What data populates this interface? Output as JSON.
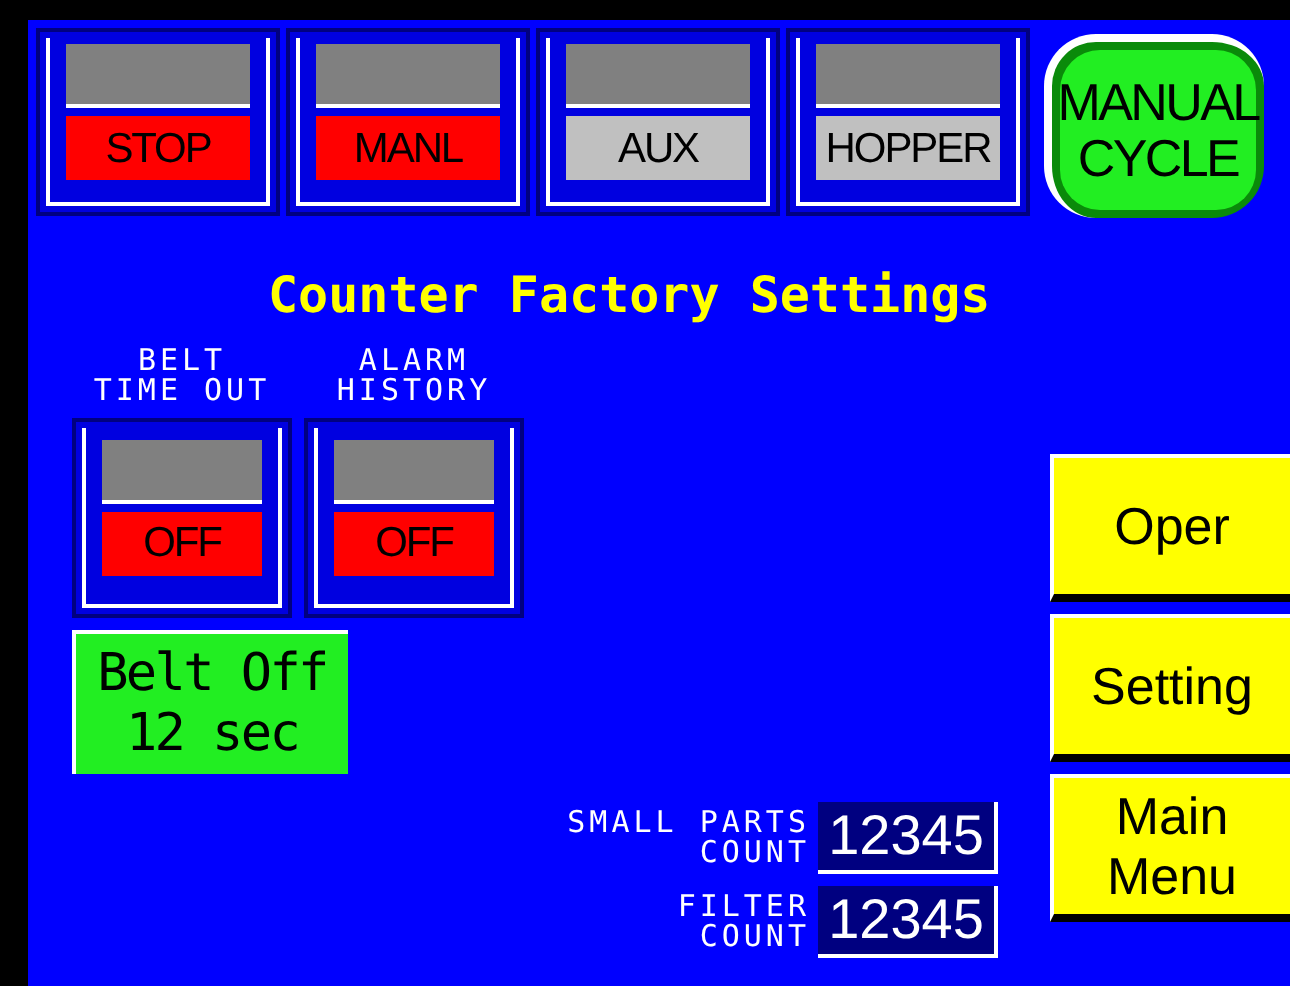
{
  "indicators": [
    {
      "label": "STOP",
      "color": "#ff0000"
    },
    {
      "label": "MANL",
      "color": "#ff0000"
    },
    {
      "label": "AUX",
      "color": "#c0c0c0"
    },
    {
      "label": "HOPPER",
      "color": "#c0c0c0"
    }
  ],
  "manual_cycle": {
    "label_lines": [
      "MANUAL",
      "CYCLE"
    ]
  },
  "title": "Counter Factory Settings",
  "switches": [
    {
      "caption_lines": [
        "BELT",
        "TIME OUT"
      ],
      "label": "OFF",
      "color": "#ff0000"
    },
    {
      "caption_lines": [
        "ALARM",
        "HISTORY"
      ],
      "label": "OFF",
      "color": "#ff0000"
    }
  ],
  "belt_off": {
    "lines": [
      "Belt Off",
      "12 sec"
    ]
  },
  "counts": [
    {
      "label_lines": [
        "SMALL PARTS",
        "COUNT"
      ],
      "value": "12345"
    },
    {
      "label_lines": [
        "FILTER",
        "COUNT"
      ],
      "value": "12345"
    }
  ],
  "nav_buttons": [
    {
      "lines": [
        "Oper"
      ]
    },
    {
      "lines": [
        "Setting"
      ]
    },
    {
      "lines": [
        "Main",
        "Menu"
      ]
    }
  ]
}
